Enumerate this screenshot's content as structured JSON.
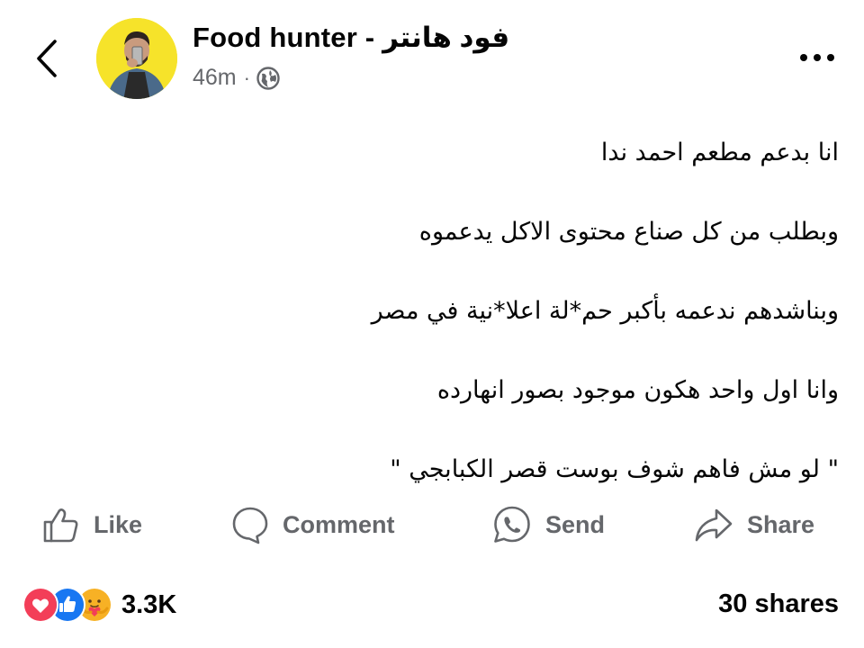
{
  "post": {
    "author_name": "Food hunter - فود هانتر",
    "time": "46m",
    "separator": "·",
    "audience_icon": "globe-icon",
    "body_lines": [
      "انا بدعم مطعم احمد ندا",
      "وبطلب من كل صناع محتوى الاكل يدعموه",
      "وبناشدهم ندعمه بأكبر حم*لة اعلا*نية في مصر",
      "وانا اول واحد هكون موجود بصور انهارده",
      "\" لو مش فاهم شوف بوست قصر الكبابجي \""
    ]
  },
  "actions": {
    "like_label": "Like",
    "comment_label": "Comment",
    "send_label": "Send",
    "share_label": "Share"
  },
  "stats": {
    "reaction_icons": [
      "love-reaction-icon",
      "like-reaction-icon",
      "care-reaction-icon"
    ],
    "reactions_count": "3.3K",
    "shares_text": "30 shares"
  },
  "colors": {
    "text_primary": "#050505",
    "text_secondary": "#65676b",
    "like_blue": "#1877f2",
    "love_red": "#f33e58",
    "care_yellow": "#f7b125",
    "avatar_bg": "#f6e32a"
  }
}
